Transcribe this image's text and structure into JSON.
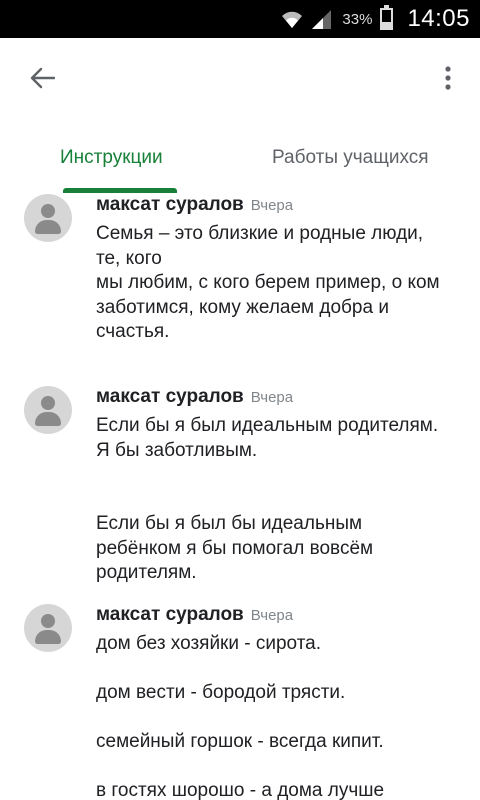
{
  "status": {
    "battery": "33%",
    "battery_level": 0.33,
    "time": "14:05"
  },
  "tabs": {
    "instructions": "Инструкции",
    "student_work": "Работы учащихся"
  },
  "comments": [
    {
      "author": "максат суралов",
      "time": "Вчера",
      "lines": [
        "Семья – это близкие и родные люди, те, кого",
        "мы любим, с кого берем пример, о ком",
        "заботимся, кому желаем добра и счастья."
      ]
    },
    {
      "author": "максат суралов",
      "time": "Вчера",
      "lines": [
        "Если бы я был идеальным родителям. Я бы заботливым.",
        "",
        "",
        "Если бы я был бы идеальным ребёнком я бы помогал вовсём родителям."
      ]
    },
    {
      "author": "максат суралов",
      "time": "Вчера",
      "lines": [
        "дом без хозяйки - сирота.",
        "",
        "дом вести - бородой трясти.",
        "",
        "семейный горшок - всегда кипит.",
        "",
        "в гостях шорошо - а дома лучше"
      ]
    }
  ],
  "icons": {
    "back": "arrow-back-icon",
    "more": "more-vert-icon",
    "avatar": "account-circle-icon"
  },
  "colors": {
    "accent": "#188038",
    "statusbar": "#000000"
  }
}
